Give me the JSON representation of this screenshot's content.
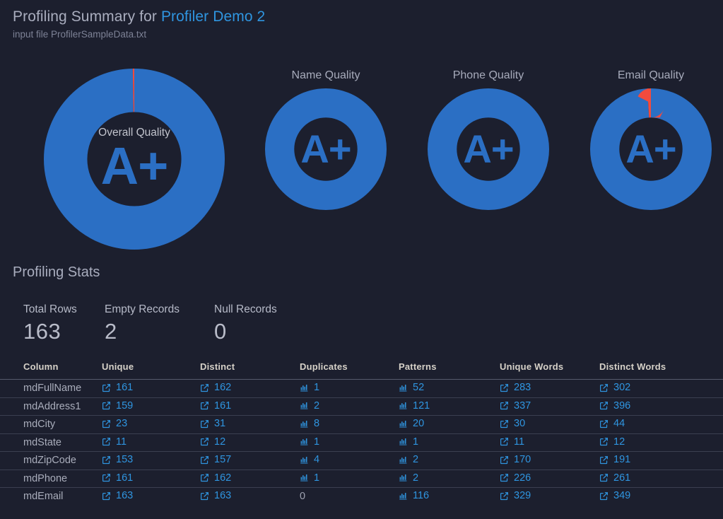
{
  "header": {
    "title_prefix": "Profiling Summary for ",
    "title_highlight": "Profiler Demo 2",
    "subtitle": "input file ProfilerSampleData.txt"
  },
  "colors": {
    "background": "#1c1f2e",
    "ring_good": "#2b6fc4",
    "ring_bad": "#f24b3d",
    "link": "#2f95e0",
    "text_muted": "#9fa3b2",
    "heading": "#a9adbe"
  },
  "quality_cards": [
    {
      "id": "overall-quality",
      "caption": "Overall Quality",
      "caption_inside": true,
      "grade": "A+",
      "good_pct": 99.7,
      "bad_pct": 0.3
    },
    {
      "id": "name-quality",
      "caption": "Name Quality",
      "caption_inside": false,
      "grade": "A+",
      "good_pct": 100,
      "bad_pct": 0
    },
    {
      "id": "phone-quality",
      "caption": "Phone Quality",
      "caption_inside": false,
      "grade": "A+",
      "good_pct": 100,
      "bad_pct": 0
    },
    {
      "id": "email-quality",
      "caption": "Email Quality",
      "caption_inside": false,
      "grade": "A+",
      "good_pct": 99,
      "bad_pct": 1
    }
  ],
  "stats": {
    "heading": "Profiling Stats",
    "items": [
      {
        "label": "Total Rows",
        "value": "163"
      },
      {
        "label": "Empty Records",
        "value": "2"
      },
      {
        "label": "Null Records",
        "value": "0"
      }
    ]
  },
  "table": {
    "headers": [
      "Column",
      "Unique",
      "Distinct",
      "Duplicates",
      "Patterns",
      "Unique Words",
      "Distinct Words"
    ],
    "rows": [
      {
        "column": "mdFullName",
        "unique": {
          "value": "161",
          "icon": "external-link-icon",
          "link": true
        },
        "distinct": {
          "value": "162",
          "icon": "external-link-icon",
          "link": true
        },
        "duplicates": {
          "value": "1",
          "icon": "bar-chart-icon",
          "link": true
        },
        "patterns": {
          "value": "52",
          "icon": "bar-chart-icon",
          "link": true
        },
        "unique_words": {
          "value": "283",
          "icon": "external-link-icon",
          "link": true
        },
        "distinct_words": {
          "value": "302",
          "icon": "external-link-icon",
          "link": true
        }
      },
      {
        "column": "mdAddress1",
        "unique": {
          "value": "159",
          "icon": "external-link-icon",
          "link": true
        },
        "distinct": {
          "value": "161",
          "icon": "external-link-icon",
          "link": true
        },
        "duplicates": {
          "value": "2",
          "icon": "bar-chart-icon",
          "link": true
        },
        "patterns": {
          "value": "121",
          "icon": "bar-chart-icon",
          "link": true
        },
        "unique_words": {
          "value": "337",
          "icon": "external-link-icon",
          "link": true
        },
        "distinct_words": {
          "value": "396",
          "icon": "external-link-icon",
          "link": true
        }
      },
      {
        "column": "mdCity",
        "unique": {
          "value": "23",
          "icon": "external-link-icon",
          "link": true
        },
        "distinct": {
          "value": "31",
          "icon": "external-link-icon",
          "link": true
        },
        "duplicates": {
          "value": "8",
          "icon": "bar-chart-icon",
          "link": true
        },
        "patterns": {
          "value": "20",
          "icon": "bar-chart-icon",
          "link": true
        },
        "unique_words": {
          "value": "30",
          "icon": "external-link-icon",
          "link": true
        },
        "distinct_words": {
          "value": "44",
          "icon": "external-link-icon",
          "link": true
        }
      },
      {
        "column": "mdState",
        "unique": {
          "value": "11",
          "icon": "external-link-icon",
          "link": true
        },
        "distinct": {
          "value": "12",
          "icon": "external-link-icon",
          "link": true
        },
        "duplicates": {
          "value": "1",
          "icon": "bar-chart-icon",
          "link": true
        },
        "patterns": {
          "value": "1",
          "icon": "bar-chart-icon",
          "link": true
        },
        "unique_words": {
          "value": "11",
          "icon": "external-link-icon",
          "link": true
        },
        "distinct_words": {
          "value": "12",
          "icon": "external-link-icon",
          "link": true
        }
      },
      {
        "column": "mdZipCode",
        "unique": {
          "value": "153",
          "icon": "external-link-icon",
          "link": true
        },
        "distinct": {
          "value": "157",
          "icon": "external-link-icon",
          "link": true
        },
        "duplicates": {
          "value": "4",
          "icon": "bar-chart-icon",
          "link": true
        },
        "patterns": {
          "value": "2",
          "icon": "bar-chart-icon",
          "link": true
        },
        "unique_words": {
          "value": "170",
          "icon": "external-link-icon",
          "link": true
        },
        "distinct_words": {
          "value": "191",
          "icon": "external-link-icon",
          "link": true
        }
      },
      {
        "column": "mdPhone",
        "unique": {
          "value": "161",
          "icon": "external-link-icon",
          "link": true
        },
        "distinct": {
          "value": "162",
          "icon": "external-link-icon",
          "link": true
        },
        "duplicates": {
          "value": "1",
          "icon": "bar-chart-icon",
          "link": true
        },
        "patterns": {
          "value": "2",
          "icon": "bar-chart-icon",
          "link": true
        },
        "unique_words": {
          "value": "226",
          "icon": "external-link-icon",
          "link": true
        },
        "distinct_words": {
          "value": "261",
          "icon": "external-link-icon",
          "link": true
        }
      },
      {
        "column": "mdEmail",
        "unique": {
          "value": "163",
          "icon": "external-link-icon",
          "link": true
        },
        "distinct": {
          "value": "163",
          "icon": "external-link-icon",
          "link": true
        },
        "duplicates": {
          "value": "0",
          "icon": null,
          "link": false
        },
        "patterns": {
          "value": "116",
          "icon": "bar-chart-icon",
          "link": true
        },
        "unique_words": {
          "value": "329",
          "icon": "external-link-icon",
          "link": true
        },
        "distinct_words": {
          "value": "349",
          "icon": "external-link-icon",
          "link": true
        }
      }
    ]
  }
}
